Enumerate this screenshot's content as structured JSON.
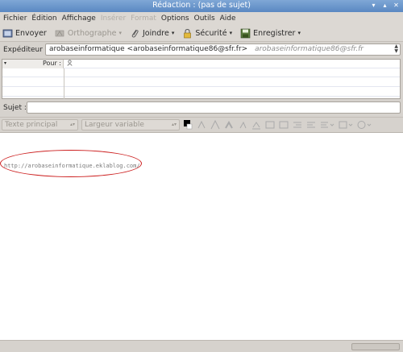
{
  "window": {
    "title": "Rédaction : (pas de sujet)"
  },
  "menu": [
    {
      "label": "Fichier",
      "disabled": false
    },
    {
      "label": "Édition",
      "disabled": false
    },
    {
      "label": "Affichage",
      "disabled": false
    },
    {
      "label": "Insérer",
      "disabled": true
    },
    {
      "label": "Format",
      "disabled": true
    },
    {
      "label": "Options",
      "disabled": false
    },
    {
      "label": "Outils",
      "disabled": false
    },
    {
      "label": "Aide",
      "disabled": false
    }
  ],
  "toolbar": {
    "send": "Envoyer",
    "spelling": "Orthographe",
    "attach": "Joindre",
    "security": "Sécurité",
    "save": "Enregistrer"
  },
  "header": {
    "from_label": "Expéditeur :",
    "from_value": "arobaseinformatique <arobaseinformatique86@sfr.fr>",
    "from_secondary": "arobaseinformatique86@sfr.fr",
    "recipient_type": "Pour :",
    "subject_label": "Sujet :",
    "subject_value": ""
  },
  "format": {
    "paragraph": "Texte principal",
    "font": "Largeur variable"
  },
  "body": {
    "text": "http://arobaseinformatique.eklablog.com/"
  },
  "colors": {
    "accent_titlebar": "#5a88c2",
    "annotation": "#cc1e1e"
  }
}
